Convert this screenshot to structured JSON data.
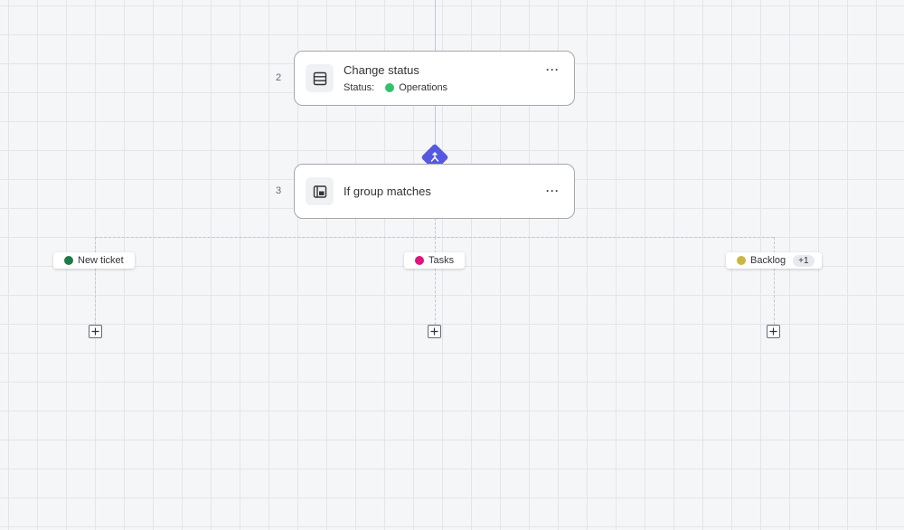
{
  "steps": [
    {
      "number": "2",
      "title": "Change status",
      "icon": "table-icon",
      "status_label": "Status:",
      "status_value": "Operations",
      "status_color": "#33c26c",
      "more": "···"
    },
    {
      "number": "3",
      "title": "If group matches",
      "icon": "group-icon",
      "more": "···"
    }
  ],
  "branches": [
    {
      "label": "New ticket",
      "color": "#1f7a47"
    },
    {
      "label": "Tasks",
      "color": "#e3127e"
    },
    {
      "label": "Backlog",
      "color": "#cab641",
      "extra": "+1"
    }
  ],
  "condition_icon": "split-arrow-icon",
  "condition_color": "#5559df"
}
